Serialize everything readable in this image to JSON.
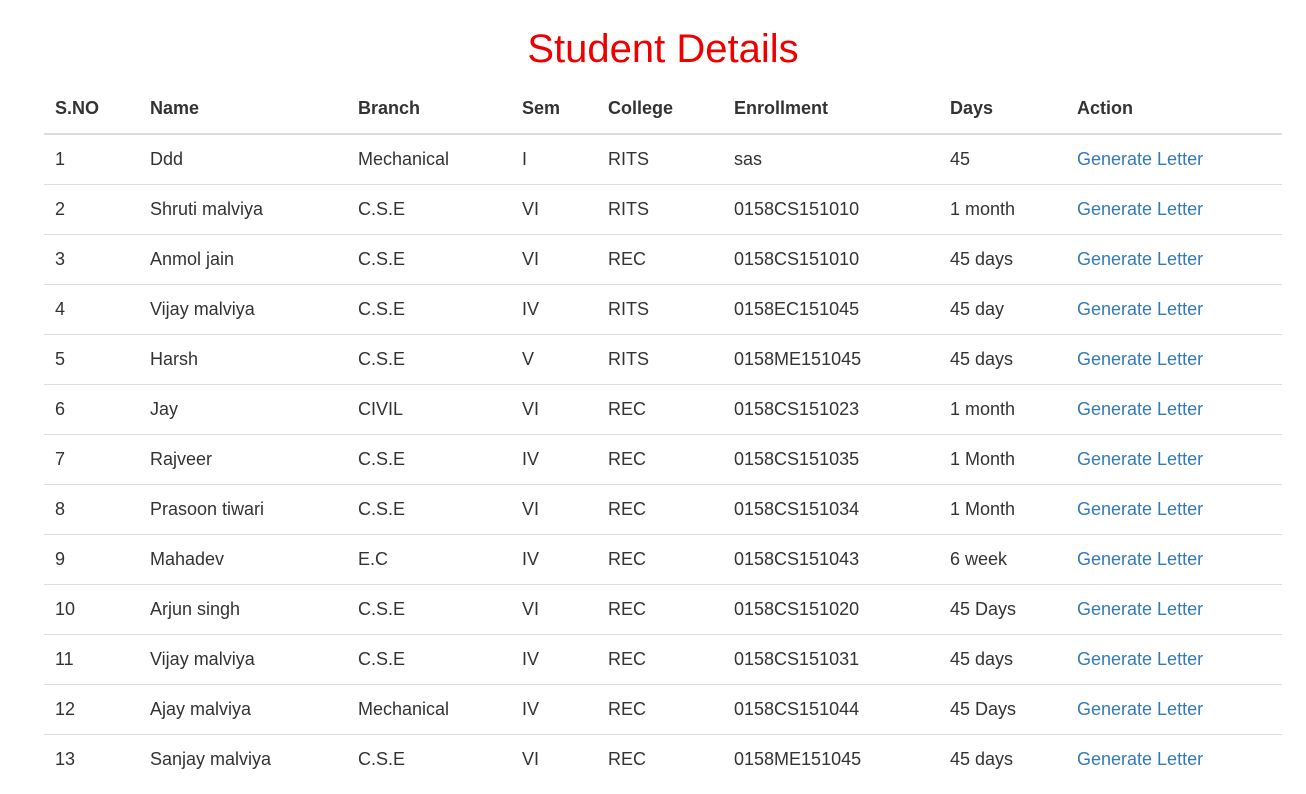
{
  "page": {
    "title": "Student Details"
  },
  "table": {
    "headers": [
      "S.NO",
      "Name",
      "Branch",
      "Sem",
      "College",
      "Enrollment",
      "Days",
      "Action"
    ],
    "rows": [
      {
        "sno": "1",
        "name": "Ddd",
        "branch": "Mechanical",
        "sem": "I",
        "college": "RITS",
        "enrollment": "sas",
        "days": "45",
        "action": "Generate Letter"
      },
      {
        "sno": "2",
        "name": "Shruti malviya",
        "branch": "C.S.E",
        "sem": "VI",
        "college": "RITS",
        "enrollment": "0158CS151010",
        "days": "1 month",
        "action": "Generate Letter"
      },
      {
        "sno": "3",
        "name": "Anmol jain",
        "branch": "C.S.E",
        "sem": "VI",
        "college": "REC",
        "enrollment": "0158CS151010",
        "days": "45 days",
        "action": "Generate Letter"
      },
      {
        "sno": "4",
        "name": "Vijay malviya",
        "branch": "C.S.E",
        "sem": "IV",
        "college": "RITS",
        "enrollment": "0158EC151045",
        "days": "45 day",
        "action": "Generate Letter"
      },
      {
        "sno": "5",
        "name": "Harsh",
        "branch": "C.S.E",
        "sem": "V",
        "college": "RITS",
        "enrollment": "0158ME151045",
        "days": "45 days",
        "action": "Generate Letter"
      },
      {
        "sno": "6",
        "name": "Jay",
        "branch": "CIVIL",
        "sem": "VI",
        "college": "REC",
        "enrollment": "0158CS151023",
        "days": "1 month",
        "action": "Generate Letter"
      },
      {
        "sno": "7",
        "name": "Rajveer",
        "branch": "C.S.E",
        "sem": "IV",
        "college": "REC",
        "enrollment": "0158CS151035",
        "days": "1 Month",
        "action": "Generate Letter"
      },
      {
        "sno": "8",
        "name": "Prasoon tiwari",
        "branch": "C.S.E",
        "sem": "VI",
        "college": "REC",
        "enrollment": "0158CS151034",
        "days": "1 Month",
        "action": "Generate Letter"
      },
      {
        "sno": "9",
        "name": "Mahadev",
        "branch": "E.C",
        "sem": "IV",
        "college": "REC",
        "enrollment": "0158CS151043",
        "days": "6 week",
        "action": "Generate Letter"
      },
      {
        "sno": "10",
        "name": "Arjun singh",
        "branch": "C.S.E",
        "sem": "VI",
        "college": "REC",
        "enrollment": "0158CS151020",
        "days": "45 Days",
        "action": "Generate Letter"
      },
      {
        "sno": "11",
        "name": "Vijay malviya",
        "branch": "C.S.E",
        "sem": "IV",
        "college": "REC",
        "enrollment": "0158CS151031",
        "days": "45 days",
        "action": "Generate Letter"
      },
      {
        "sno": "12",
        "name": "Ajay malviya",
        "branch": "Mechanical",
        "sem": "IV",
        "college": "REC",
        "enrollment": "0158CS151044",
        "days": "45 Days",
        "action": "Generate Letter"
      },
      {
        "sno": "13",
        "name": "Sanjay malviya",
        "branch": "C.S.E",
        "sem": "VI",
        "college": "REC",
        "enrollment": "0158ME151045",
        "days": "45 days",
        "action": "Generate Letter"
      }
    ]
  },
  "colors": {
    "title": "#ee0000",
    "link": "#337ab7",
    "text": "#333333",
    "border": "#dddddd"
  }
}
